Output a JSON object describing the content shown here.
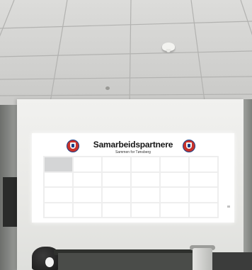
{
  "board": {
    "title": "Samarbeidspartnere",
    "subtitle": "Sammen for Tønsberg",
    "grid": {
      "columns": 6,
      "rows": 4,
      "highlighted_cell": 0
    }
  },
  "colors": {
    "logo_red": "#c8312a",
    "logo_blue": "#1b3f86",
    "wall": "#ececea",
    "ceiling": "#d4d4d2"
  }
}
